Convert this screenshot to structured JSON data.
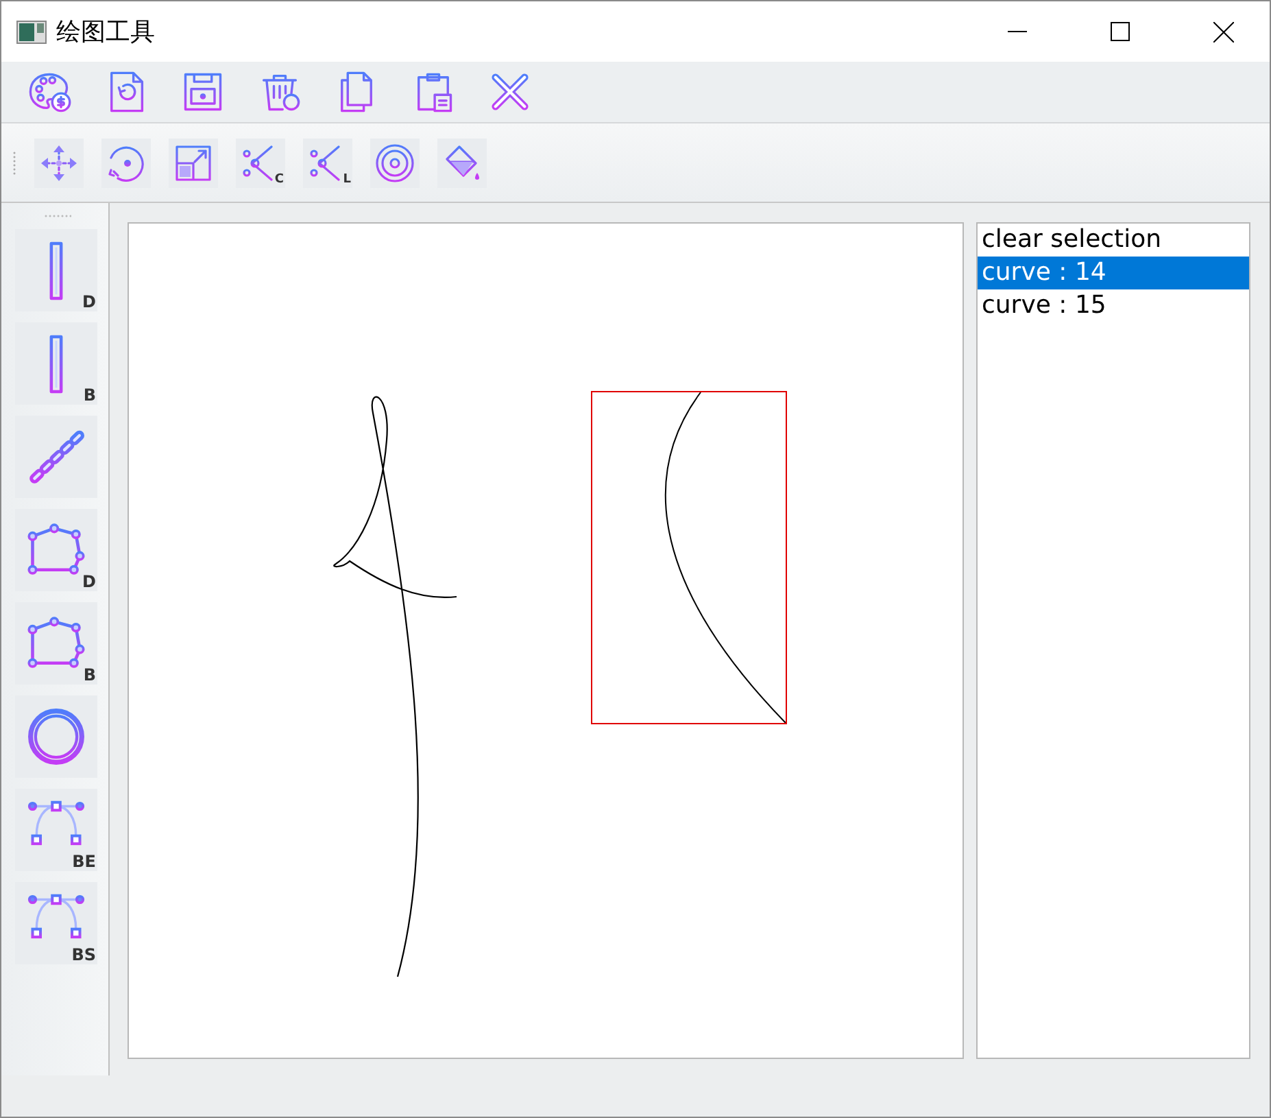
{
  "window": {
    "title": "绘图工具"
  },
  "file_toolbar": [
    {
      "kind": "palette"
    },
    {
      "kind": "reload"
    },
    {
      "kind": "save"
    },
    {
      "kind": "trash"
    },
    {
      "kind": "copy"
    },
    {
      "kind": "paste"
    },
    {
      "kind": "close"
    }
  ],
  "edit_toolbar": [
    {
      "kind": "move"
    },
    {
      "kind": "rotate"
    },
    {
      "kind": "scale"
    },
    {
      "kind": "cut",
      "badge": "C"
    },
    {
      "kind": "cut",
      "badge": "L"
    },
    {
      "kind": "target"
    },
    {
      "kind": "fill"
    }
  ],
  "shape_tools": [
    {
      "kind": "bar",
      "badge": "D"
    },
    {
      "kind": "bar",
      "badge": "B"
    },
    {
      "kind": "dashes"
    },
    {
      "kind": "polygon",
      "badge": "D"
    },
    {
      "kind": "polygon",
      "badge": "B"
    },
    {
      "kind": "ring"
    },
    {
      "kind": "arc",
      "badge": "BE"
    },
    {
      "kind": "arc",
      "badge": "BS"
    }
  ],
  "selection_list": [
    {
      "label": "clear selection",
      "selected": false
    },
    {
      "label": "curve : 14",
      "selected": true
    },
    {
      "label": "curve : 15",
      "selected": false
    }
  ]
}
